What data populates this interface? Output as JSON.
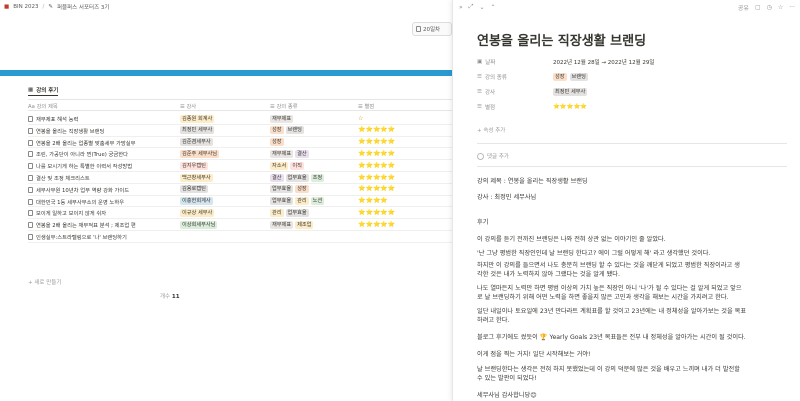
{
  "topbar": {
    "workspace": "BIN 2023",
    "separator": "/",
    "page": "퍼블퍼스 서포터즈 3기"
  },
  "cover_pill": "20일차",
  "db_tab": "강의 후기",
  "columns": {
    "title": "강의 제목",
    "instructor": "강사",
    "category": "강의 종류",
    "rating": "별점"
  },
  "rows": [
    {
      "title": "재무제표 해석 능력",
      "instructor": "김종원 회계사",
      "inst_color": "#fdecc8",
      "cats": [
        {
          "t": "재무제표",
          "c": "#e9e5e3"
        }
      ],
      "rating": "☆"
    },
    {
      "title": "연봉을 올리는 직장생활 브랜딩",
      "instructor": "최정민 세무사",
      "inst_color": "#e3e2e0",
      "cats": [
        {
          "t": "성장",
          "c": "#fadec9"
        },
        {
          "t": "브랜딩",
          "c": "#e3e2e0"
        }
      ],
      "rating": "⭐⭐⭐⭐⭐"
    },
    {
      "title": "연봉을 2배 올리는 업종별 맞춤세무 가망실무",
      "instructor": "김준겸세무사",
      "inst_color": "#e3e2e0",
      "cats": [
        {
          "t": "성장",
          "c": "#fadec9"
        }
      ],
      "rating": "⭐⭐⭐⭐⭐"
    },
    {
      "title": "조린, 가공단이 아니라 찐(True) 궁금한다",
      "instructor": "김준주 세무사님",
      "inst_color": "#fadec9",
      "cats": [
        {
          "t": "재무제표",
          "c": "#e9e5e3"
        },
        {
          "t": "결산",
          "c": "#e8deee"
        }
      ],
      "rating": "⭐⭐⭐⭐⭐"
    },
    {
      "title": "나를 모시기게 하는 특별한 이력서 작성방법",
      "instructor": "김지우캡틴",
      "inst_color": "#ffe2dd",
      "cats": [
        {
          "t": "자소서",
          "c": "#fdecc8"
        },
        {
          "t": "이직",
          "c": "#ffe2dd"
        }
      ],
      "rating": "⭐⭐⭐⭐⭐"
    },
    {
      "title": "결산 및 조정 체크리스트",
      "instructor": "백근창세무사",
      "inst_color": "#fdecc8",
      "cats": [
        {
          "t": "결산",
          "c": "#e8deee"
        },
        {
          "t": "업무효율",
          "c": "#e3e2e0"
        },
        {
          "t": "조정",
          "c": "#dbeddb"
        }
      ],
      "rating": "⭐⭐⭐⭐⭐"
    },
    {
      "title": "세무사무원 10년차 업무 역량 강화 가이드",
      "instructor": "김용로캡틴",
      "inst_color": "#e3e2e0",
      "cats": [
        {
          "t": "업무효율",
          "c": "#e3e2e0"
        },
        {
          "t": "성장",
          "c": "#fadec9"
        }
      ],
      "rating": "⭐⭐⭐⭐⭐"
    },
    {
      "title": "대한민국 1등 세무사무소의 운영 노하우",
      "instructor": "이충헌회계사",
      "inst_color": "#d3e5ef",
      "cats": [
        {
          "t": "업무효율",
          "c": "#e3e2e0"
        },
        {
          "t": "관리",
          "c": "#fdecc8"
        },
        {
          "t": "노션",
          "c": "#dbeddb"
        }
      ],
      "rating": "⭐⭐⭐⭐"
    },
    {
      "title": "보이게 일하고 보이지 않게 쉬자",
      "instructor": "이규상 세무사",
      "inst_color": "#fdecc8",
      "cats": [
        {
          "t": "관리",
          "c": "#fdecc8"
        },
        {
          "t": "업무효율",
          "c": "#e3e2e0"
        }
      ],
      "rating": "⭐⭐⭐⭐⭐"
    },
    {
      "title": "연봉을 2배 올리는 재무적표 분석 ; 제조업 편",
      "instructor": "이상희세무사님",
      "inst_color": "#dbeddb",
      "cats": [
        {
          "t": "재무제표",
          "c": "#e9e5e3"
        },
        {
          "t": "제조업",
          "c": "#fdecc8"
        }
      ],
      "rating": "⭐⭐⭐⭐⭐"
    },
    {
      "title": "인생실무:스트라텔링으로 '나' 브랜딩하기",
      "instructor": "",
      "inst_color": "",
      "cats": [],
      "rating": ""
    }
  ],
  "new_row": "+ 새로 만들기",
  "count_label": "개수",
  "count_value": "11",
  "panel": {
    "share": "공유",
    "title": "연봉을 올리는 직장생활 브랜딩",
    "props": [
      {
        "label": "날짜",
        "value": "2022년 12월 28일 → 2022년 12월 29일"
      },
      {
        "label": "강의 종류",
        "tags": [
          {
            "t": "성장",
            "c": "#fadec9"
          },
          {
            "t": "브랜딩",
            "c": "#e3e2e0"
          }
        ]
      },
      {
        "label": "강사",
        "tags": [
          {
            "t": "최정민 세무사",
            "c": "#e3e2e0"
          }
        ]
      },
      {
        "label": "별점",
        "value": "⭐⭐⭐⭐⭐"
      }
    ],
    "add_prop": "+ 속성 추가",
    "comment": "댓글 추가",
    "lines": [
      "강의 제목 : 연봉을 올리는 직장생활 브랜딩",
      "강사 : 최정민 세무사님",
      "",
      "후기",
      "이 강의를 듣기 전까진 브랜딩은 나와 전혀 상관 없는 이야기인 줄 알았다.",
      "'난 그냥 평범한 직장인인데 날 브랜딩 한다고? 에이 그럴 어떻게 해' 라고 생각했던 것이다.",
      "하지만 이 강의를 들으면서 나도 충분히 브랜딩 할 수 있다는 것을 깨닫게 되었고 평범한 직장이라고 생",
      "각한 것은 내가 노력하지 않아 그랬다는 것을 알게 됐다.",
      "나도 열마든지 노력만 하면 평범 이상의 가치 높은 직장인 아니 '나'가 될 수 있다는 걸 알게 되었고 앞으",
      "로 날 브랜딩하기 위해 어떤 노력을 하면 좋을지 많은 고민과 생각을 해보는 시간을 가지려고 한다.",
      "일단 내일이나 토요일에 23년 만다라트 계획표를 할 것이고 23년에는 내 정체성을 알아가보는 것을 목표",
      "하려고 한다.",
      "블로그 후기에도 썼듯이 🏆 Yearly Goals 23년 목표들은 전부 내 정체성을 알아가는 시간이 될 것이다.",
      "이게 점을 찍는 거지! 일단 시작해보는 거야!",
      "날 브랜딩한다는 생각은 전혀 하지 못했었는데 이 강의 덕분에 많은 것을 배우고 느끼며 내가 더 발전할",
      "수 있는 발판이 되었다!",
      "세무사님 감사합니당😊"
    ]
  }
}
